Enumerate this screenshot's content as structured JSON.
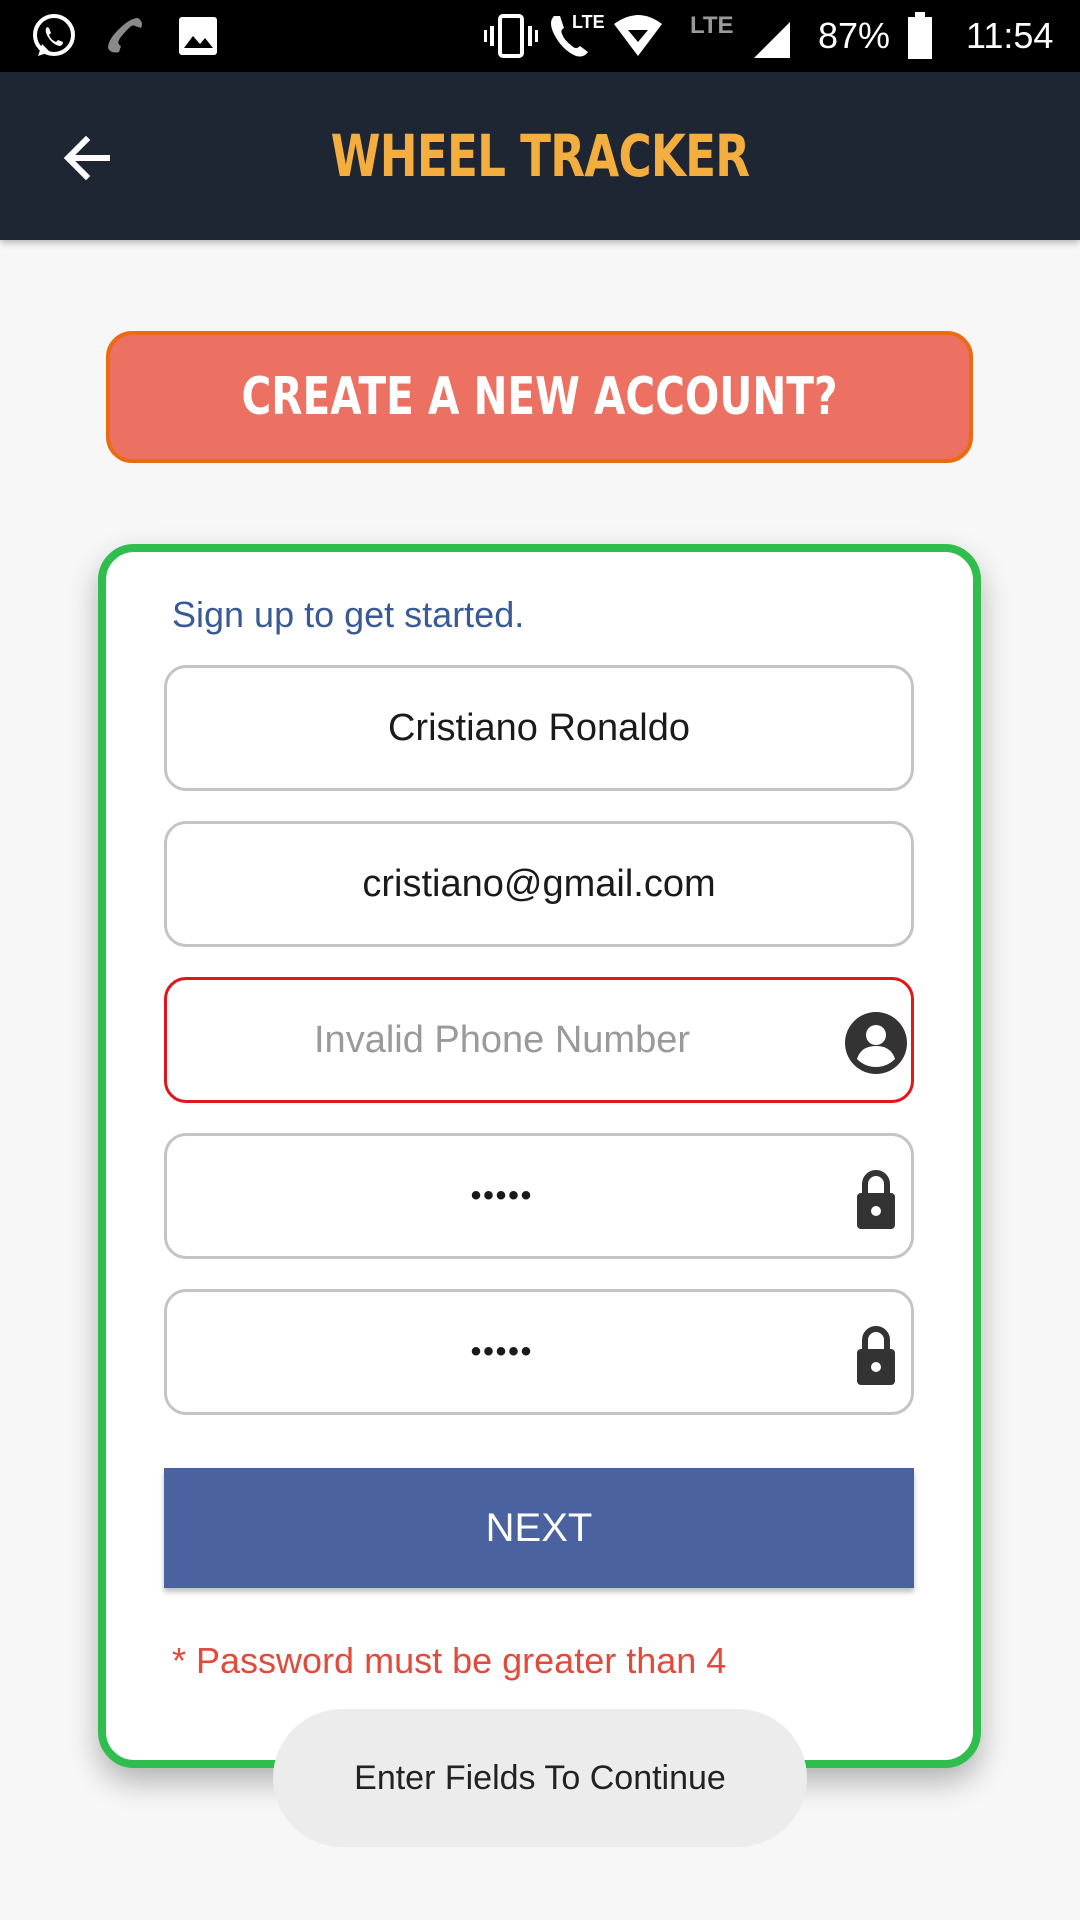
{
  "status_bar": {
    "battery": "87%",
    "time": "11:54",
    "network_label": "LTE",
    "icons": [
      "whatsapp-icon",
      "missed-call-icon",
      "image-icon",
      "vibrate-icon",
      "volte-call-icon",
      "wifi-icon",
      "signal-icon",
      "battery-icon"
    ]
  },
  "app_bar": {
    "title": "WHEEL TRACKER",
    "back_icon": "arrow-left-icon",
    "title_color": "#f4ad3f",
    "background": "#1e2633"
  },
  "create_account": {
    "label": "CREATE A NEW ACCOUNT?",
    "color": "#ec7163",
    "border_color": "#ec6a12"
  },
  "form": {
    "caption": "Sign up to get started.",
    "card_border_color": "#2fbd4e",
    "fields": {
      "name": {
        "value": "Cristiano Ronaldo"
      },
      "email": {
        "value": "cristiano@gmail.com"
      },
      "phone": {
        "placeholder": "Invalid Phone Number",
        "icon": "account-circle-icon",
        "state": "error"
      },
      "password": {
        "value": "•••••",
        "icon": "lock-icon"
      },
      "confirm_password": {
        "value": "•••••",
        "icon": "lock-icon"
      }
    },
    "next_label": "NEXT",
    "next_color": "#4a63a0",
    "error_message": "* Password must be greater than 4"
  },
  "toast": {
    "message": "Enter Fields To Continue"
  }
}
